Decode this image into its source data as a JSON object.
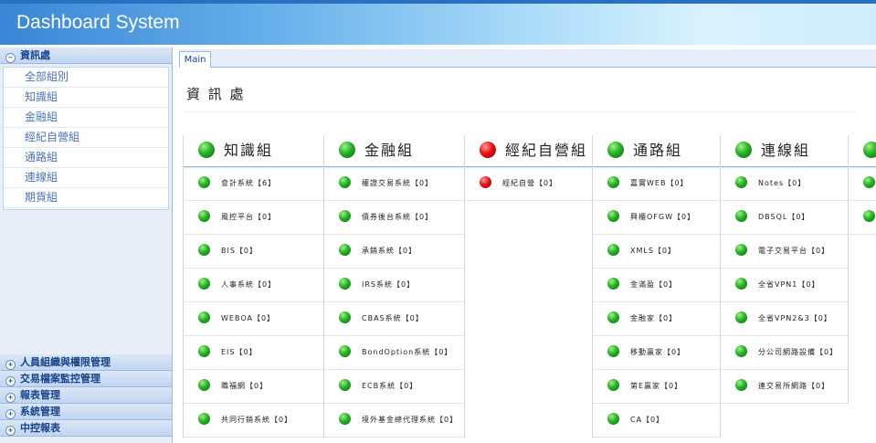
{
  "app": {
    "title": "Dashboard System"
  },
  "sidebar": {
    "active_section": "資訊處",
    "items": [
      "全部組別",
      "知識組",
      "金融組",
      "經紀自營組",
      "通路組",
      "連線組",
      "期貨組"
    ],
    "sections": [
      "人員組織與權限管理",
      "交易檔案監控管理",
      "報表管理",
      "系統管理",
      "中控報表"
    ]
  },
  "tabs": [
    "Main"
  ],
  "page": {
    "title": "資 訊 處"
  },
  "colors": {
    "status_ok": "#26b126",
    "status_alert": "#e81414",
    "accent": "#15428b"
  },
  "groups": [
    {
      "name": "知識組",
      "status": "green",
      "items": [
        {
          "label": "會計系統【6】",
          "status": "green"
        },
        {
          "label": "風控平台【0】",
          "status": "green"
        },
        {
          "label": "BIS【0】",
          "status": "green"
        },
        {
          "label": "人事系統【0】",
          "status": "green"
        },
        {
          "label": "WEBOA【0】",
          "status": "green"
        },
        {
          "label": "EIS【0】",
          "status": "green"
        },
        {
          "label": "職福網【0】",
          "status": "green"
        },
        {
          "label": "共同行銷系統【0】",
          "status": "green"
        }
      ]
    },
    {
      "name": "金融組",
      "status": "green",
      "items": [
        {
          "label": "權證交易系統【0】",
          "status": "green"
        },
        {
          "label": "債券後台系統【0】",
          "status": "green"
        },
        {
          "label": "承銷系統【0】",
          "status": "green"
        },
        {
          "label": "IRS系統【0】",
          "status": "green"
        },
        {
          "label": "CBAS系統【0】",
          "status": "green"
        },
        {
          "label": "BondOption系統【0】",
          "status": "green"
        },
        {
          "label": "ECB系統【0】",
          "status": "green"
        },
        {
          "label": "境外基金總代理系統【0】",
          "status": "green"
        }
      ]
    },
    {
      "name": "經紀自營組",
      "status": "red",
      "items": [
        {
          "label": "經紀自營【0】",
          "status": "red"
        }
      ]
    },
    {
      "name": "通路組",
      "status": "green",
      "items": [
        {
          "label": "嘉實WEB【0】",
          "status": "green"
        },
        {
          "label": "興櫃OFGW【0】",
          "status": "green"
        },
        {
          "label": "XMLS【0】",
          "status": "green"
        },
        {
          "label": "金滿盈【0】",
          "status": "green"
        },
        {
          "label": "金融家【0】",
          "status": "green"
        },
        {
          "label": "移動贏家【0】",
          "status": "green"
        },
        {
          "label": "第E贏家【0】",
          "status": "green"
        },
        {
          "label": "CA【0】",
          "status": "green"
        }
      ]
    },
    {
      "name": "連線組",
      "status": "green",
      "items": [
        {
          "label": "Notes【0】",
          "status": "green"
        },
        {
          "label": "DBSQL【0】",
          "status": "green"
        },
        {
          "label": "電子交易平台【0】",
          "status": "green"
        },
        {
          "label": "全省VPN1【0】",
          "status": "green"
        },
        {
          "label": "全省VPN2&3【0】",
          "status": "green"
        },
        {
          "label": "分公司網路設備【0】",
          "status": "green"
        },
        {
          "label": "連交易所網路【0】",
          "status": "green"
        }
      ]
    },
    {
      "name": "",
      "status": "green",
      "items": [
        {
          "label": "",
          "status": "green"
        },
        {
          "label": "",
          "status": "green"
        }
      ]
    }
  ]
}
